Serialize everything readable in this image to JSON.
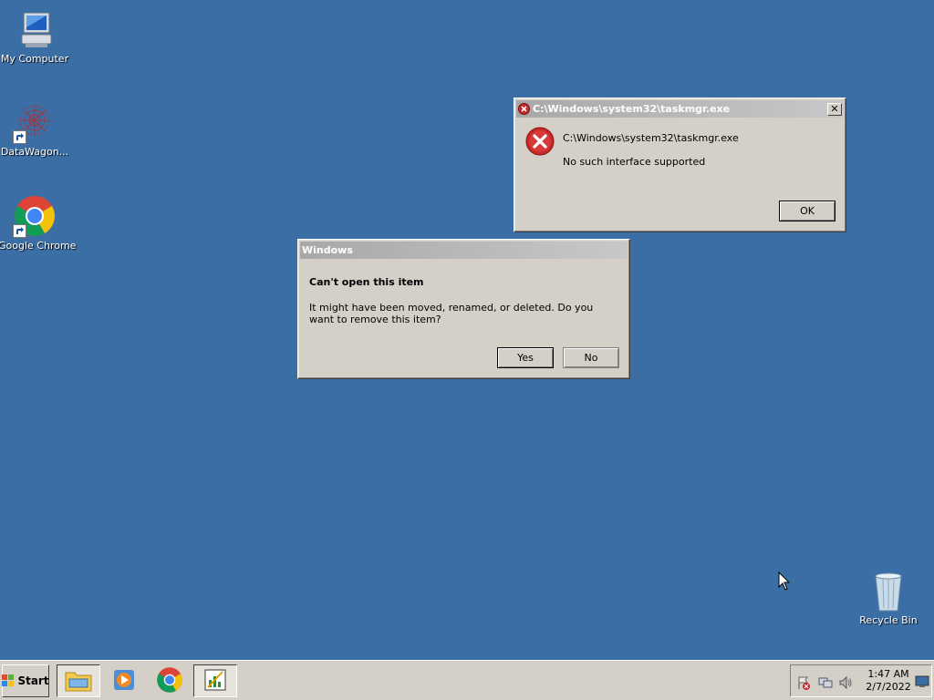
{
  "desktop_icons": [
    {
      "label": "My Computer"
    },
    {
      "label": "DataWagon..."
    },
    {
      "label": "Google Chrome"
    },
    {
      "label": "Recycle Bin"
    }
  ],
  "error_dialog": {
    "title": "C:\\Windows\\system32\\taskmgr.exe",
    "path": "C:\\Windows\\system32\\taskmgr.exe",
    "message": "No such interface supported",
    "ok_label": "OK",
    "close_label": "✕"
  },
  "windows_dialog": {
    "title": "Windows",
    "heading": "Can't open this item",
    "message": "It might have been moved, renamed, or deleted. Do you want to remove this item?",
    "yes_label": "Yes",
    "no_label": "No"
  },
  "taskbar": {
    "start_label": "Start",
    "apps": [
      "file-explorer-icon",
      "media-player-icon",
      "chrome-icon",
      "chart-app-icon"
    ],
    "clock_time": "1:47 AM",
    "clock_date": "2/7/2022"
  },
  "colors": {
    "desktop": "#3a6ea5",
    "chrome_face": "#d4d0c8",
    "error_red": "#c62828"
  }
}
